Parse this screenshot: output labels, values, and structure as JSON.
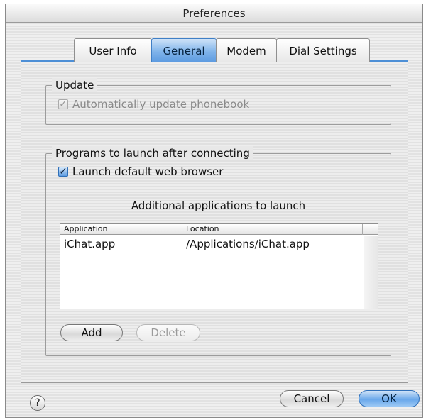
{
  "window": {
    "title": "Preferences"
  },
  "tabs": [
    {
      "label": "User Info",
      "active": false
    },
    {
      "label": "General",
      "active": true
    },
    {
      "label": "Modem",
      "active": false
    },
    {
      "label": "Dial Settings",
      "active": false
    }
  ],
  "update": {
    "legend": "Update",
    "auto_update_label": "Automatically update phonebook",
    "auto_update_checked": true,
    "auto_update_enabled": false
  },
  "programs": {
    "legend": "Programs to launch after connecting",
    "launch_browser_label": "Launch default web browser",
    "launch_browser_checked": true,
    "additional_heading": "Additional applications to launch",
    "columns": [
      "Application",
      "Location"
    ],
    "rows": [
      {
        "application": "iChat.app",
        "location": "/Applications/iChat.app"
      }
    ],
    "add_label": "Add",
    "delete_label": "Delete"
  },
  "footer": {
    "help_label": "?",
    "cancel_label": "Cancel",
    "ok_label": "OK"
  },
  "colors": {
    "accent": "#5b9ae0",
    "pane_border": "#9a9a9a"
  }
}
